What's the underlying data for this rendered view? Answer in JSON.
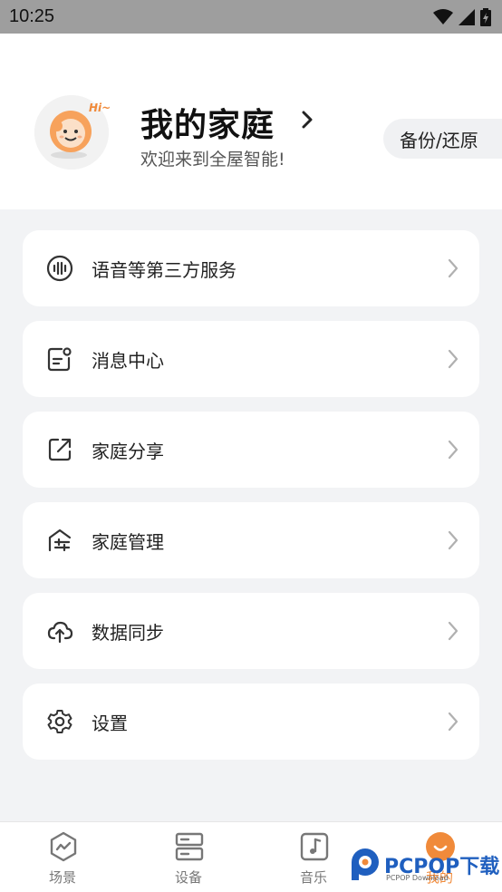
{
  "status_bar": {
    "time": "10:25"
  },
  "header": {
    "avatar_badge": "Hi~",
    "title": "我的家庭",
    "subtitle": "欢迎来到全屋智能!",
    "backup_button": "备份/还原"
  },
  "menu": [
    {
      "label": "语音等第三方服务",
      "icon": "voice-wave-icon"
    },
    {
      "label": "消息中心",
      "icon": "message-icon"
    },
    {
      "label": "家庭分享",
      "icon": "share-icon"
    },
    {
      "label": "家庭管理",
      "icon": "home-manage-icon"
    },
    {
      "label": "数据同步",
      "icon": "cloud-upload-icon"
    },
    {
      "label": "设置",
      "icon": "gear-icon"
    }
  ],
  "bottom_nav": [
    {
      "label": "场景",
      "icon": "scene-icon",
      "active": false
    },
    {
      "label": "设备",
      "icon": "device-icon",
      "active": false
    },
    {
      "label": "音乐",
      "icon": "music-icon",
      "active": false
    },
    {
      "label": "我的",
      "icon": "mine-icon",
      "active": true
    }
  ],
  "watermark": {
    "brand": "PCPOP下载",
    "sub": "PCPOP Download"
  },
  "colors": {
    "accent": "#f08a3a",
    "icon_gray": "#333333",
    "chevron": "#b0b0b0"
  }
}
